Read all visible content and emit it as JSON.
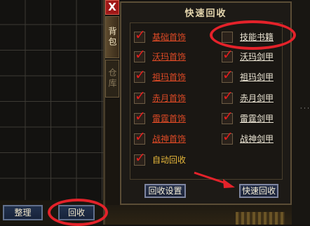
{
  "inventory": {
    "buttons": {
      "arrange_label": "整理",
      "recycle_label": "回收"
    }
  },
  "side_tabs": {
    "close_label": "X",
    "bag_label": "背包",
    "warehouse_label": "仓库"
  },
  "panel": {
    "title": "快速回收",
    "left_items": [
      {
        "label": "基础首饰",
        "checked": true
      },
      {
        "label": "沃玛首饰",
        "checked": true
      },
      {
        "label": "祖玛首饰",
        "checked": true
      },
      {
        "label": "赤月首饰",
        "checked": true
      },
      {
        "label": "雷霆首饰",
        "checked": true
      },
      {
        "label": "战神首饰",
        "checked": true
      }
    ],
    "right_items": [
      {
        "label": "技能书籍",
        "checked": false
      },
      {
        "label": "沃玛剑甲",
        "checked": true
      },
      {
        "label": "祖玛剑甲",
        "checked": true
      },
      {
        "label": "赤月剑甲",
        "checked": true
      },
      {
        "label": "雷霆剑甲",
        "checked": true
      },
      {
        "label": "战神剑甲",
        "checked": true
      }
    ],
    "auto_recycle": {
      "label": "自动回收",
      "checked": true
    },
    "settings_button_label": "回收设置",
    "quick_button_label": "快速回收"
  },
  "colors": {
    "annotation": "#e4222a",
    "tick": "#e21e1e",
    "left_label": "#dd4a26",
    "right_label": "#eee7d6",
    "auto_label": "#e8b83a"
  },
  "edge_dots": "· · ·"
}
